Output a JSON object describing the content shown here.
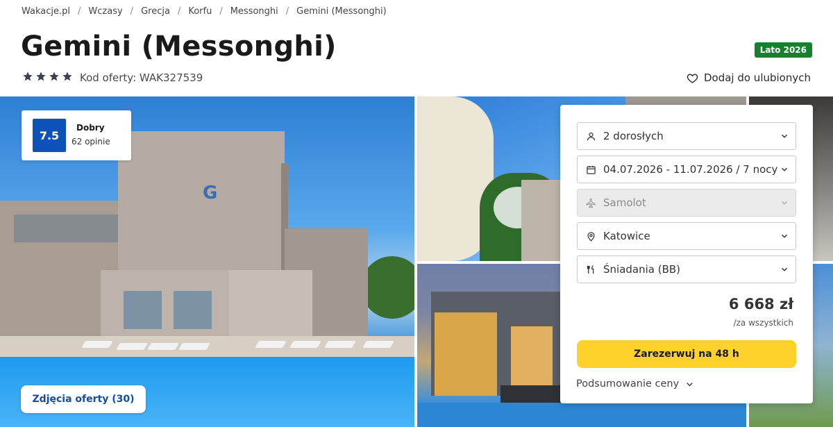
{
  "breadcrumb": {
    "items": [
      "Wakacje.pl",
      "Wczasy",
      "Grecja",
      "Korfu",
      "Messonghi",
      "Gemini (Messonghi)"
    ],
    "separator": "/"
  },
  "hotel": {
    "name": "Gemini (Messonghi)",
    "stars": 4,
    "offer_code": "Kod oferty: WAK327539",
    "season_badge": "Lato 2026",
    "favorite_label": "Dodaj do ulubionych"
  },
  "rating": {
    "score": "7.5",
    "label": "Dobry",
    "count": "62 opinie"
  },
  "gallery": {
    "photos_button": "Zdjęcia oferty (30)"
  },
  "booking": {
    "travellers": "2 dorosłych",
    "dates": "04.07.2026 - 11.07.2026 / 7 nocy",
    "transport": "Samolot",
    "departure": "Katowice",
    "board": "Śniadania (BB)",
    "price": "6 668 zł",
    "price_note": "/za wszystkich",
    "reserve_label": "Zarezerwuj na 48 h",
    "summary_label": "Podsumowanie ceny"
  },
  "colors": {
    "brand_blue": "#0c52b8",
    "season_green": "#15812e",
    "cta_yellow": "#fed22b"
  },
  "icons": [
    "star-icon",
    "heart-icon",
    "person-icon",
    "calendar-icon",
    "plane-icon",
    "location-pin-icon",
    "cutlery-icon",
    "chevron-down-icon"
  ]
}
